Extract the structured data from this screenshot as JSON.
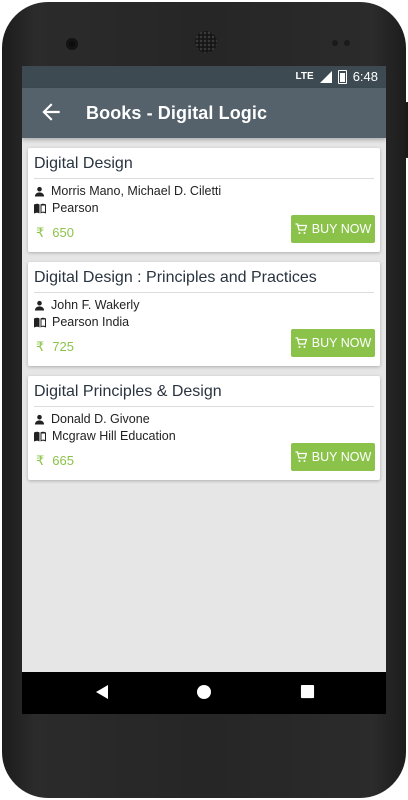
{
  "status_bar": {
    "network": "LTE",
    "time": "6:48"
  },
  "app_bar": {
    "title": "Books - Digital Logic",
    "back_icon": "arrow-back-icon"
  },
  "books": [
    {
      "title": "Digital Design",
      "authors": "Morris Mano, Michael D. Ciletti",
      "publisher": "Pearson",
      "currency": "₹",
      "price": "650",
      "buy_label": "BUY NOW"
    },
    {
      "title": "Digital Design : Principles and Practices",
      "authors": "John F. Wakerly",
      "publisher": "Pearson India",
      "currency": "₹",
      "price": "725",
      "buy_label": "BUY NOW"
    },
    {
      "title": "Digital Principles & Design",
      "authors": "Donald D. Givone",
      "publisher": "Mcgraw Hill Education",
      "currency": "₹",
      "price": "665",
      "buy_label": "BUY NOW"
    }
  ],
  "colors": {
    "app_bar": "#55626b",
    "status_bar": "#3d4a52",
    "accent_green": "#8bc34a",
    "background": "#e6e6e6"
  }
}
